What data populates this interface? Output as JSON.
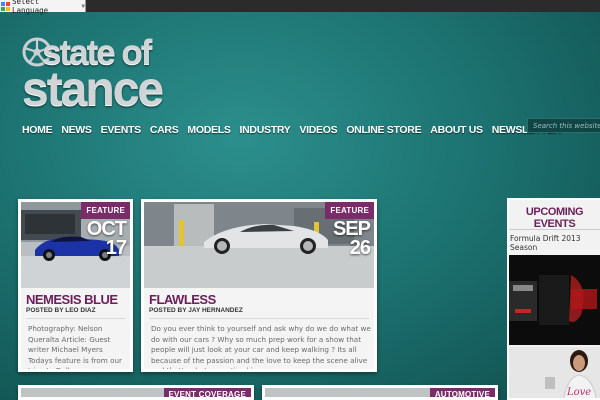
{
  "translate": {
    "label": "Select Language",
    "chevron": "▼",
    "icon": "google-translate-icon"
  },
  "logo": {
    "line1": "state of",
    "line2": "stance"
  },
  "nav": {
    "items": [
      "HOME",
      "NEWS",
      "EVENTS",
      "CARS",
      "MODELS",
      "INDUSTRY",
      "VIDEOS",
      "ONLINE STORE",
      "ABOUT US",
      "NEWSLETTER"
    ]
  },
  "search": {
    "placeholder": "Search this website..."
  },
  "colors": {
    "accent": "#7a2c68",
    "title": "#6a1f59",
    "background": "#1d7472"
  },
  "posts": [
    {
      "tag": "FEATURE",
      "month": "OCT",
      "day": "17",
      "title": "NEMESIS BLUE",
      "byline": "POSTED BY LEO DIAZ",
      "excerpt": "Photography: Nelson Queralta Article: Guest writer Michael Myers Todays feature is from our trips to Dallas"
    },
    {
      "tag": "FEATURE",
      "month": "SEP",
      "day": "26",
      "title": "FLAWLESS",
      "byline": "POSTED BY JAY HERNANDEZ",
      "excerpt": "Do you ever think to yourself and ask why do we do what we do with our cars ? Why so much prep work for a show that people will just look at your car and keep walking ? Its all because of the passion and the love to keep the scene alive and that's what we noticed in"
    }
  ],
  "bottom_tags": [
    "EVENT COVERAGE",
    "AUTOMOTIVE"
  ],
  "sidebar": {
    "heading": "UPCOMING EVENTS",
    "event": "Formula Drift 2013 Season"
  }
}
